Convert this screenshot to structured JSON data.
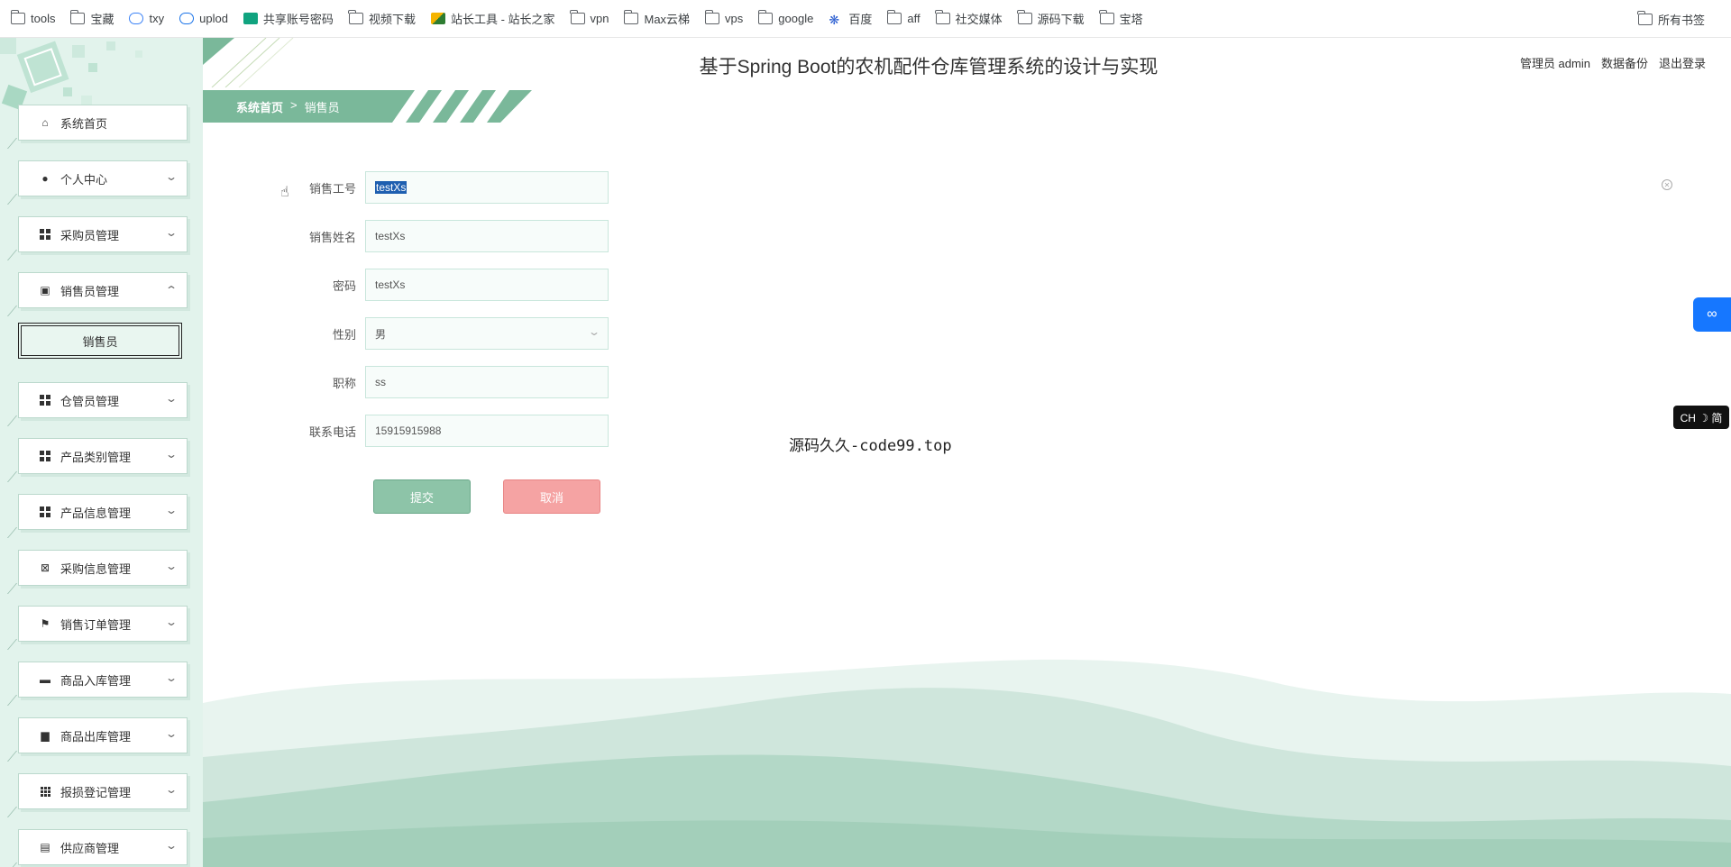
{
  "bookmarks": {
    "items": [
      {
        "label": "tools",
        "icon": "folder-icon"
      },
      {
        "label": "宝藏",
        "icon": "folder-icon"
      },
      {
        "label": "txy",
        "icon": "cloud-icon"
      },
      {
        "label": "uplod",
        "icon": "link-icon"
      },
      {
        "label": "共享账号密码",
        "icon": "sheet-icon"
      },
      {
        "label": "视频下载",
        "icon": "folder-icon"
      },
      {
        "label": "站长工具 - 站长之家",
        "icon": "tool-icon"
      },
      {
        "label": "vpn",
        "icon": "folder-icon"
      },
      {
        "label": "Max云梯",
        "icon": "folder-icon"
      },
      {
        "label": "vps",
        "icon": "folder-icon"
      },
      {
        "label": "google",
        "icon": "folder-icon"
      },
      {
        "label": "百度",
        "icon": "paw-icon"
      },
      {
        "label": "aff",
        "icon": "folder-icon"
      },
      {
        "label": "社交媒体",
        "icon": "folder-icon"
      },
      {
        "label": "源码下载",
        "icon": "folder-icon"
      },
      {
        "label": "宝塔",
        "icon": "folder-icon"
      }
    ],
    "all_bookmarks": "所有书签"
  },
  "header": {
    "title": "基于Spring Boot的农机配件仓库管理系统的设计与实现",
    "user": "管理员 admin",
    "backup": "数据备份",
    "logout": "退出登录"
  },
  "breadcrumb": {
    "home": "系统首页",
    "separator": ">",
    "current": "销售员"
  },
  "sidebar": {
    "items": [
      {
        "label": "系统首页",
        "icon": "home-icon"
      },
      {
        "label": "个人中心",
        "icon": "user-icon"
      },
      {
        "label": "采购员管理",
        "icon": "grid-icon"
      },
      {
        "label": "销售员管理",
        "icon": "clipboard-icon"
      },
      {
        "label": "仓管员管理",
        "icon": "grid-icon"
      },
      {
        "label": "产品类别管理",
        "icon": "grid-icon"
      },
      {
        "label": "产品信息管理",
        "icon": "grid-icon"
      },
      {
        "label": "采购信息管理",
        "icon": "trash-x-icon"
      },
      {
        "label": "销售订单管理",
        "icon": "flag-icon"
      },
      {
        "label": "商品入库管理",
        "icon": "briefcase-icon"
      },
      {
        "label": "商品出库管理",
        "icon": "inbox-icon"
      },
      {
        "label": "报损登记管理",
        "icon": "grid9-icon"
      },
      {
        "label": "供应商管理",
        "icon": "chat-icon"
      }
    ],
    "sub_item": "销售员"
  },
  "form": {
    "fields": [
      {
        "label": "销售工号",
        "value": "testXs"
      },
      {
        "label": "销售姓名",
        "value": "testXs"
      },
      {
        "label": "密码",
        "value": "testXs"
      },
      {
        "label": "性别",
        "value": "男"
      },
      {
        "label": "职称",
        "value": "ss"
      },
      {
        "label": "联系电话",
        "value": "15915915988"
      }
    ],
    "submit": "提交",
    "cancel": "取消"
  },
  "watermark": "源码久久-code99.top",
  "lang_toggle": "CH ☽ 简",
  "colors": {
    "sidebar_bg": "#e2f3ec",
    "accent_green": "#7ab89a",
    "submit_btn": "#8dc4a8",
    "cancel_btn": "#f5a3a3",
    "float_btn": "#1677ff"
  }
}
